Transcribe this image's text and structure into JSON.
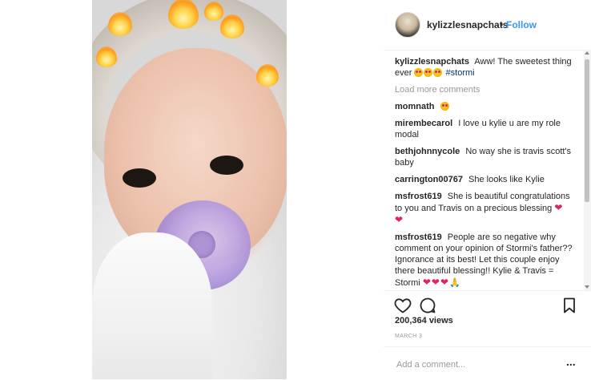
{
  "post": {
    "username": "kylizzlesnapchats",
    "separator": "•",
    "follow_label": "Follow",
    "caption_user": "kylizzlesnapchats",
    "caption_text": "Aww! The sweetest thing ever",
    "caption_hashtag": "#stormi",
    "load_more": "Load more comments",
    "comments": [
      {
        "user": "momnath",
        "text": ""
      },
      {
        "user": "mirembecarol",
        "text": "I love u kylie u are my role modal"
      },
      {
        "user": "bethjohnnycole",
        "text": "No way she is travis scott's baby"
      },
      {
        "user": "carrington00767",
        "text": "She looks like Kylie"
      },
      {
        "user": "msfrost619",
        "text": "She is beautiful congratulations to you and Travis on a precious blessing"
      },
      {
        "user": "msfrost619",
        "text": "People are so negative why comment on your opinion of Stormi's father?? Ignorance at its best! Let this couple enjoy there beautiful blessing!! Kylie & Travis = Stormi"
      }
    ],
    "views": "200,364 views",
    "date": "MARCH 3",
    "add_comment_placeholder": "Add a comment...",
    "more_label": "..."
  },
  "icons": {
    "like": "heart-icon",
    "comment": "comment-bubble-icon",
    "save": "bookmark-icon"
  },
  "colors": {
    "follow": "#3897f0",
    "muted": "#999999",
    "heart": "#e0245e"
  }
}
